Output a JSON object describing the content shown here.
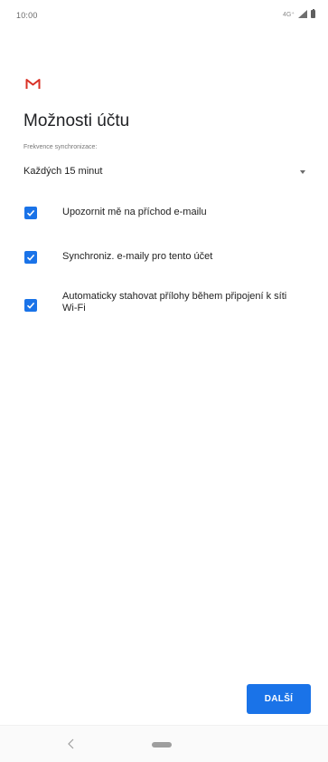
{
  "status_bar": {
    "time": "10:00",
    "network": "4G⁺",
    "icons": [
      "signal-icon",
      "battery-icon"
    ]
  },
  "app": {
    "logo": "gmail-logo",
    "accent_color": "#1a73e8",
    "logo_color": "#d93025"
  },
  "screen": {
    "title": "Možnosti účtu"
  },
  "sync": {
    "label": "Frekvence synchronizace:",
    "selected_value": "Každých 15 minut"
  },
  "options": [
    {
      "label": "Upozornit mě na příchod e-mailu",
      "checked": true
    },
    {
      "label": "Synchroniz. e-maily pro tento účet",
      "checked": true
    },
    {
      "label": "Automaticky stahovat přílohy během připojení k síti Wi-Fi",
      "checked": true
    }
  ],
  "actions": {
    "next_label": "DALŠÍ"
  },
  "nav_bar": {
    "icons": [
      "back-icon",
      "home-pill"
    ]
  }
}
